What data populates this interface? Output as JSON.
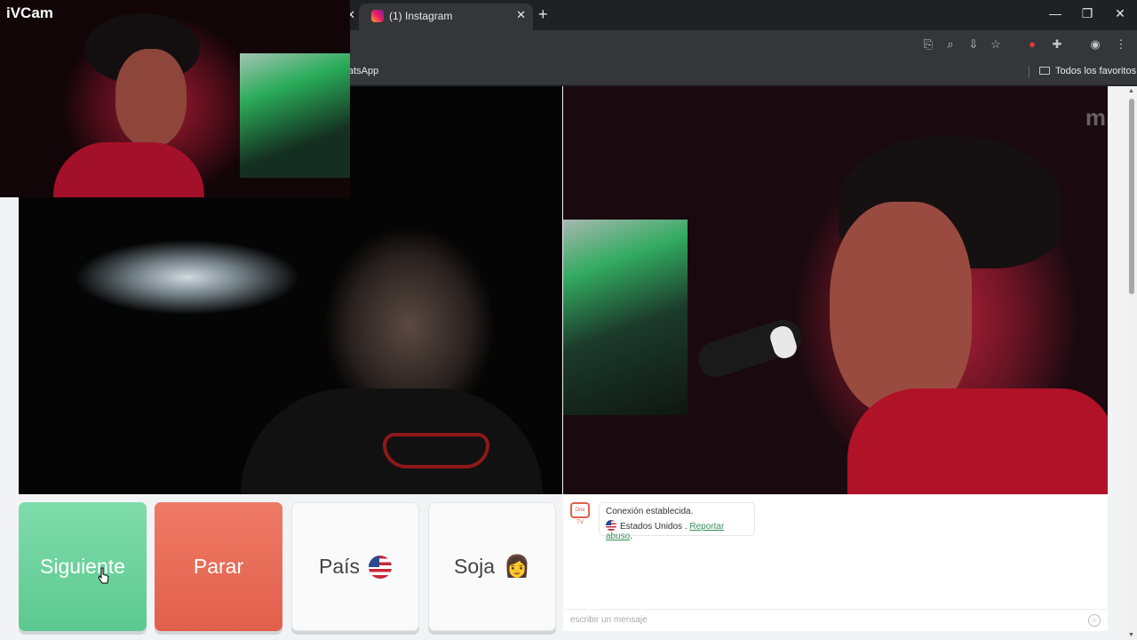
{
  "browser": {
    "tabs": [
      {
        "label": ""
      },
      {
        "label": "(1) Instagram"
      }
    ],
    "bookmark_partial": "atsApp",
    "bookmarks_folder": "Todos los favoritos"
  },
  "ivcam": {
    "title": "iVCam"
  },
  "watermark": "m",
  "buttons": {
    "next": "Siguiente",
    "stop": "Parar",
    "country": "País",
    "gender": "Soja",
    "gender_emoji": "👩"
  },
  "chat": {
    "tv_label": "One TV",
    "status": "Conexión establecida.",
    "country": "Estados Unidos",
    "separator": " . ",
    "report": "Reportar abuso",
    "input_placeholder": "escribir un mensaje"
  },
  "colors": {
    "next": "#6bd29d",
    "stop": "#e86b56",
    "report_link": "#3a8f5a"
  }
}
